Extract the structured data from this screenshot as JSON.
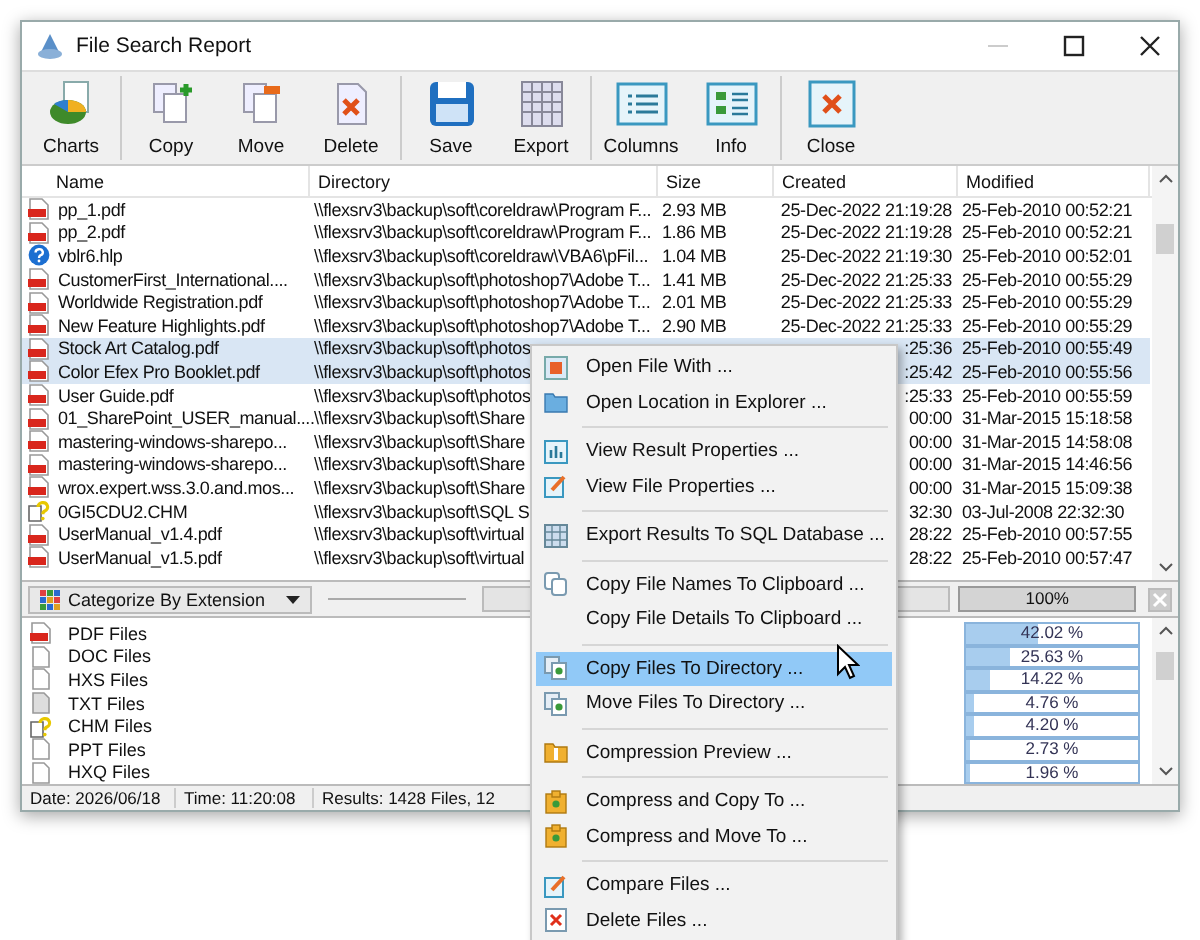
{
  "window": {
    "title": "File Search Report"
  },
  "toolbar_groups": [
    {
      "buttons": [
        {
          "label": "Charts",
          "kind": "charts"
        }
      ]
    },
    {
      "buttons": [
        {
          "label": "Copy",
          "kind": "copy"
        },
        {
          "label": "Move",
          "kind": "move"
        },
        {
          "label": "Delete",
          "kind": "delete"
        }
      ]
    },
    {
      "buttons": [
        {
          "label": "Save",
          "kind": "save"
        },
        {
          "label": "Export",
          "kind": "export"
        }
      ]
    },
    {
      "buttons": [
        {
          "label": "Columns",
          "kind": "columns"
        },
        {
          "label": "Info",
          "kind": "info"
        }
      ]
    },
    {
      "buttons": [
        {
          "label": "Close",
          "kind": "close"
        }
      ]
    }
  ],
  "table": {
    "columns": [
      "Name",
      "Directory",
      "Size",
      "Created",
      "Modified"
    ],
    "rows": [
      {
        "kind": "pdf",
        "selected": false,
        "name": "pp_1.pdf",
        "directory": "\\\\flexsrv3\\backup\\soft\\coreldraw\\Program F...",
        "size": "2.93 MB",
        "created": "25-Dec-2022 21:19:28",
        "modified": "25-Feb-2010 00:52:21"
      },
      {
        "kind": "pdf",
        "selected": false,
        "name": "pp_2.pdf",
        "directory": "\\\\flexsrv3\\backup\\soft\\coreldraw\\Program F...",
        "size": "1.86 MB",
        "created": "25-Dec-2022 21:19:28",
        "modified": "25-Feb-2010 00:52:21"
      },
      {
        "kind": "hlp",
        "selected": false,
        "name": "vblr6.hlp",
        "directory": "\\\\flexsrv3\\backup\\soft\\coreldraw\\VBA6\\pFil...",
        "size": "1.04 MB",
        "created": "25-Dec-2022 21:19:30",
        "modified": "25-Feb-2010 00:52:01"
      },
      {
        "kind": "pdf",
        "selected": false,
        "name": "CustomerFirst_International....",
        "directory": "\\\\flexsrv3\\backup\\soft\\photoshop7\\Adobe T...",
        "size": "1.41 MB",
        "created": "25-Dec-2022 21:25:33",
        "modified": "25-Feb-2010 00:55:29"
      },
      {
        "kind": "pdf",
        "selected": false,
        "name": "Worldwide Registration.pdf",
        "directory": "\\\\flexsrv3\\backup\\soft\\photoshop7\\Adobe T...",
        "size": "2.01 MB",
        "created": "25-Dec-2022 21:25:33",
        "modified": "25-Feb-2010 00:55:29"
      },
      {
        "kind": "pdf",
        "selected": false,
        "name": "New Feature Highlights.pdf",
        "directory": "\\\\flexsrv3\\backup\\soft\\photoshop7\\Adobe T...",
        "size": "2.90 MB",
        "created": "25-Dec-2022 21:25:33",
        "modified": "25-Feb-2010 00:55:29"
      },
      {
        "kind": "pdf",
        "selected": true,
        "name": "Stock Art Catalog.pdf",
        "directory": "\\\\flexsrv3\\backup\\soft\\photos",
        "created": ":25:36",
        "modified": "25-Feb-2010 00:55:49"
      },
      {
        "kind": "pdf",
        "selected": true,
        "name": "Color Efex Pro Booklet.pdf",
        "directory": "\\\\flexsrv3\\backup\\soft\\photos",
        "created": ":25:42",
        "modified": "25-Feb-2010 00:55:56"
      },
      {
        "kind": "pdf",
        "selected": false,
        "name": "User Guide.pdf",
        "directory": "\\\\flexsrv3\\backup\\soft\\photos",
        "created": ":25:33",
        "modified": "25-Feb-2010 00:55:59"
      },
      {
        "kind": "pdf",
        "selected": false,
        "name": "01_SharePoint_USER_manual....",
        "directory": "\\\\flexsrv3\\backup\\soft\\Share",
        "created": "00:00",
        "modified": "31-Mar-2015 15:18:58"
      },
      {
        "kind": "pdf",
        "selected": false,
        "name": "mastering-windows-sharepo...",
        "directory": "\\\\flexsrv3\\backup\\soft\\Share",
        "created": "00:00",
        "modified": "31-Mar-2015 14:58:08"
      },
      {
        "kind": "pdf",
        "selected": false,
        "name": "mastering-windows-sharepo...",
        "directory": "\\\\flexsrv3\\backup\\soft\\Share",
        "created": "00:00",
        "modified": "31-Mar-2015 14:46:56"
      },
      {
        "kind": "pdf",
        "selected": false,
        "name": "wrox.expert.wss.3.0.and.mos...",
        "directory": "\\\\flexsrv3\\backup\\soft\\Share",
        "created": "00:00",
        "modified": "31-Mar-2015 15:09:38"
      },
      {
        "kind": "chm",
        "selected": false,
        "name": "0GI5CDU2.CHM",
        "directory": "\\\\flexsrv3\\backup\\soft\\SQL S",
        "created": "32:30",
        "modified": "03-Jul-2008 22:32:30"
      },
      {
        "kind": "pdf",
        "selected": false,
        "name": "UserManual_v1.4.pdf",
        "directory": "\\\\flexsrv3\\backup\\soft\\virtual",
        "created": "28:22",
        "modified": "25-Feb-2010 00:57:55"
      },
      {
        "kind": "pdf",
        "selected": false,
        "name": "UserManual_v1.5.pdf",
        "directory": "\\\\flexsrv3\\backup\\soft\\virtual",
        "created": "28:22",
        "modified": "25-Feb-2010 00:57:47"
      }
    ]
  },
  "categories": {
    "mode": "Categorize By Extension",
    "progress": {
      "label": "100%",
      "level": 1
    },
    "items": [
      {
        "kind": "pdf",
        "name": "PDF Files",
        "share": "42.02 %",
        "level": 0.4202
      },
      {
        "kind": "doc",
        "name": "DOC Files",
        "share": "25.63 %",
        "level": 0.2563
      },
      {
        "kind": "doc",
        "name": "HXS Files",
        "share": "14.22 %",
        "level": 0.1422
      },
      {
        "kind": "txt",
        "name": "TXT Files",
        "share": "4.76 %",
        "level": 0.0476
      },
      {
        "kind": "chm",
        "name": "CHM Files",
        "share": "4.20 %",
        "level": 0.042
      },
      {
        "kind": "doc",
        "name": "PPT Files",
        "share": "2.73 %",
        "level": 0.0273
      },
      {
        "kind": "doc",
        "name": "HXQ Files",
        "share": "1.96 %",
        "level": 0.0196
      }
    ]
  },
  "status_bar": [
    "Date: 2026/06/18",
    "Time: 11:20:08",
    "Results: 1428 Files, 12"
  ],
  "context_menu": {
    "groups": [
      {
        "items": [
          {
            "label": "Open File With ...",
            "kind": "open-with",
            "selected": false
          },
          {
            "label": "Open Location in Explorer ...",
            "kind": "folder",
            "selected": false
          }
        ]
      },
      {
        "items": [
          {
            "label": "View Result Properties ...",
            "kind": "properties",
            "selected": false
          },
          {
            "label": "View File Properties ...",
            "kind": "edit",
            "selected": false
          }
        ]
      },
      {
        "items": [
          {
            "label": "Export Results To SQL Database ...",
            "kind": "table",
            "selected": false
          }
        ]
      },
      {
        "items": [
          {
            "label": "Copy File Names To Clipboard ...",
            "kind": "copy",
            "selected": false
          },
          {
            "label": "Copy File Details To Clipboard ...",
            "selected": false
          }
        ]
      },
      {
        "items": [
          {
            "label": "Copy Files To Directory ...",
            "kind": "copy-to",
            "selected": true
          },
          {
            "label": "Move Files To Directory ...",
            "kind": "copy-to",
            "selected": false
          }
        ]
      },
      {
        "items": [
          {
            "label": "Compression Preview ...",
            "kind": "archive",
            "selected": false
          }
        ]
      },
      {
        "items": [
          {
            "label": "Compress and Copy To ...",
            "kind": "compress",
            "selected": false
          },
          {
            "label": "Compress and Move To ...",
            "kind": "compress",
            "selected": false
          }
        ]
      },
      {
        "items": [
          {
            "label": "Compare Files ...",
            "kind": "edit",
            "selected": false
          },
          {
            "label": "Delete Files ...",
            "kind": "delete",
            "selected": false
          }
        ]
      }
    ]
  }
}
